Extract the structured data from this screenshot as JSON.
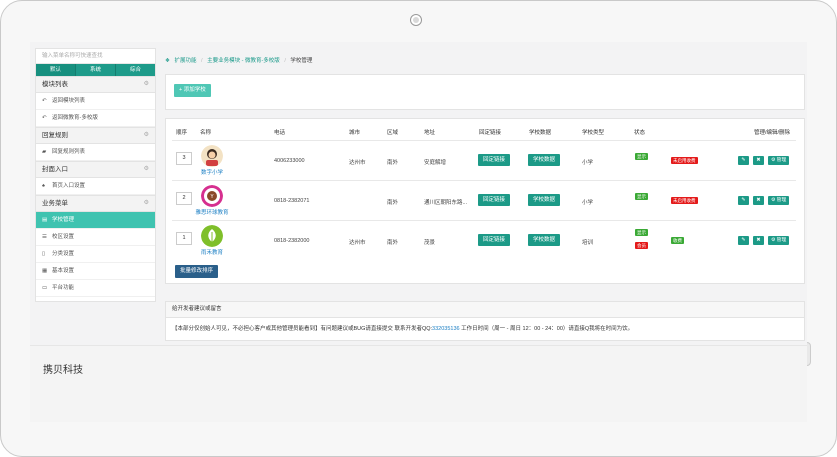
{
  "sidebar": {
    "search_placeholder": "输入菜单名称可快速查找",
    "modes": [
      "默认",
      "系统",
      "综合"
    ],
    "sections": [
      {
        "title": "模块列表",
        "items": [
          {
            "label": "返回模块列表",
            "icon": "reply-icon"
          },
          {
            "label": "返回微教育-多校版",
            "icon": "reply-icon"
          }
        ]
      },
      {
        "title": "回复规则",
        "items": [
          {
            "label": "回复规则列表",
            "icon": "comments-icon"
          }
        ]
      },
      {
        "title": "封面入口",
        "items": [
          {
            "label": "首页入口设置",
            "icon": "thumbs-up-icon"
          }
        ]
      },
      {
        "title": "业务菜单",
        "items": [
          {
            "label": "学校管理",
            "icon": "bank-icon",
            "active": true
          },
          {
            "label": "校区设置",
            "icon": "list-icon"
          },
          {
            "label": "分类设置",
            "icon": "file-icon"
          },
          {
            "label": "基本设置",
            "icon": "database-icon"
          },
          {
            "label": "平台功能",
            "icon": "desktop-icon"
          }
        ]
      }
    ]
  },
  "breadcrumb": {
    "items": [
      "扩展功能",
      "主要业务模块 - 微教育-多校版",
      "学校管理"
    ]
  },
  "actions": {
    "add_school": "+ 添加学校",
    "batch_sort": "批量修改排序"
  },
  "table": {
    "headers": [
      "顺序",
      "名称",
      "电话",
      "城市",
      "区域",
      "地址",
      "回定链接",
      "学校数据",
      "学校类型",
      "状态",
      "管理/编辑/删除"
    ],
    "rows": [
      {
        "order": "3",
        "name": "数字小学",
        "phone": "4006233000",
        "city": "达州市",
        "area": "南外",
        "address": "安庭解增",
        "link_btn": "回定链接",
        "data_btn": "学校数据",
        "type": "小学",
        "status": [
          "显示"
        ],
        "extra": "未启用收费",
        "extra_color": "red",
        "manage": "管理"
      },
      {
        "order": "2",
        "name": "雅思环球教育",
        "phone": "0818-2382071",
        "city": "",
        "area": "南外",
        "address": "通川区朝阳东路...",
        "link_btn": "回定链接",
        "data_btn": "学校数据",
        "type": "小学",
        "status": [
          "显示"
        ],
        "extra": "未启用收费",
        "extra_color": "red",
        "manage": "管理"
      },
      {
        "order": "1",
        "name": "雨禾教育",
        "phone": "0818-2382000",
        "city": "达州市",
        "area": "南外",
        "address": "茂景",
        "link_btn": "回定链接",
        "data_btn": "学校数据",
        "type": "培训",
        "status": [
          "显示",
          "会员"
        ],
        "extra": "收费",
        "extra_color": "green",
        "manage": "管理"
      }
    ]
  },
  "notice": {
    "title": "给开发者建议或留言",
    "text_before": "【本部分仅创始人可见，不必担心客户或其他管理员能看到】有问题建议或BUG请直接提交 联系开发者QQ:",
    "qq": "332035136",
    "text_after": " 工作日时间（周一 - 周日 12：00 - 24：00）请直接Q我将在时间为饮。"
  },
  "footer": {
    "brand": "携贝科技"
  },
  "colors": {
    "primary": "#1c9a87",
    "active_menu": "#3fc3b0",
    "add_button": "#4fc7b5",
    "sort_button": "#2a5f8a",
    "label_green": "#3aa935",
    "label_red": "#e41a1a"
  }
}
